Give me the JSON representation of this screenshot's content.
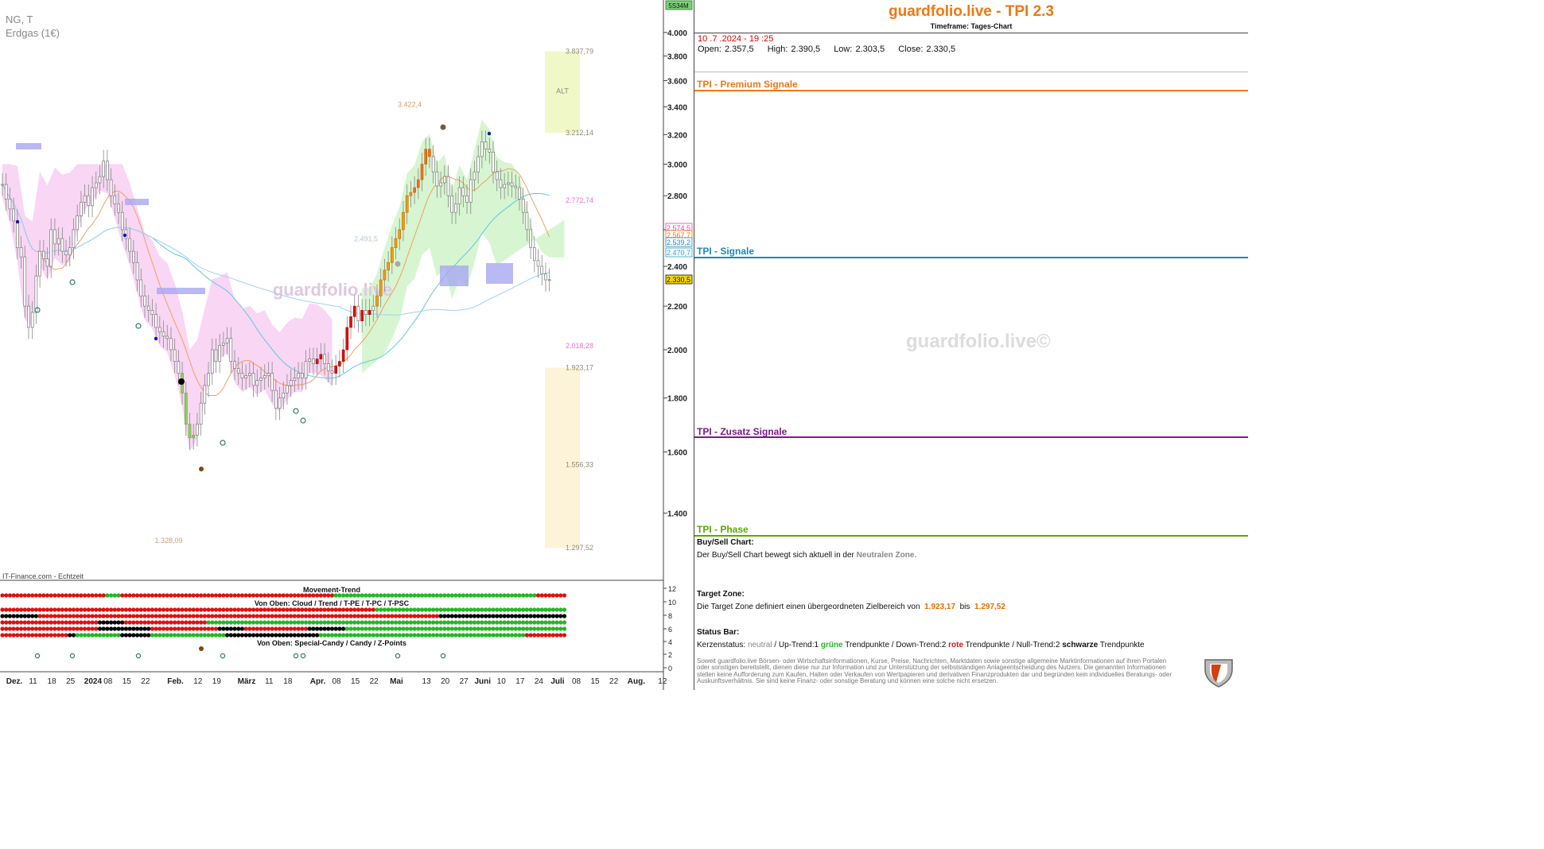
{
  "chart_header": {
    "symbol": "NG, T",
    "name": "Erdgas (1€)"
  },
  "watermark": "guardfolio.live",
  "source_label": "IT-Finance.com - Echtzeit",
  "chart_data": {
    "type": "candlestick",
    "title": "NG, T — Erdgas (1€)",
    "y_range": [
      1250,
      4080
    ],
    "y_ticks": [
      {
        "v": 4000,
        "l": "4.000"
      },
      {
        "v": 3800,
        "l": "3.800"
      },
      {
        "v": 3600,
        "l": "3.600"
      },
      {
        "v": 3400,
        "l": "3.400"
      },
      {
        "v": 3200,
        "l": "3.200"
      },
      {
        "v": 3000,
        "l": "3.000"
      },
      {
        "v": 2800,
        "l": "2.800"
      },
      {
        "v": 2600,
        "l": "2.600"
      },
      {
        "v": 2400,
        "l": "2.400"
      },
      {
        "v": 2200,
        "l": "2.200"
      },
      {
        "v": 2000,
        "l": "2.000"
      },
      {
        "v": 1800,
        "l": "1.800"
      },
      {
        "v": 1600,
        "l": "1.600"
      },
      {
        "v": 1400,
        "l": "1.400"
      }
    ],
    "x_ticks": [
      {
        "i": 0,
        "l": "Dez.",
        "b": true
      },
      {
        "i": 5,
        "l": "11"
      },
      {
        "i": 10,
        "l": "18"
      },
      {
        "i": 15,
        "l": "25"
      },
      {
        "i": 21,
        "l": "2024",
        "b": true
      },
      {
        "i": 25,
        "l": "08"
      },
      {
        "i": 30,
        "l": "15"
      },
      {
        "i": 35,
        "l": "22"
      },
      {
        "i": 43,
        "l": "Feb.",
        "b": true
      },
      {
        "i": 49,
        "l": "12"
      },
      {
        "i": 54,
        "l": "19"
      },
      {
        "i": 62,
        "l": "März",
        "b": true
      },
      {
        "i": 68,
        "l": "11"
      },
      {
        "i": 73,
        "l": "18"
      },
      {
        "i": 81,
        "l": "Apr.",
        "b": true
      },
      {
        "i": 86,
        "l": "08"
      },
      {
        "i": 91,
        "l": "15"
      },
      {
        "i": 96,
        "l": "22"
      },
      {
        "i": 102,
        "l": "Mai",
        "b": true
      },
      {
        "i": 110,
        "l": "13"
      },
      {
        "i": 115,
        "l": "20"
      },
      {
        "i": 120,
        "l": "27"
      },
      {
        "i": 125,
        "l": "Juni",
        "b": true
      },
      {
        "i": 130,
        "l": "10"
      },
      {
        "i": 135,
        "l": "17"
      },
      {
        "i": 140,
        "l": "24"
      },
      {
        "i": 145,
        "l": "Juli",
        "b": true
      },
      {
        "i": 150,
        "l": "08"
      },
      {
        "i": 155,
        "l": "15"
      },
      {
        "i": 160,
        "l": "22"
      },
      {
        "i": 166,
        "l": "Aug.",
        "b": true
      },
      {
        "i": 173,
        "l": "12"
      }
    ],
    "closes": [
      2870,
      2780,
      2720,
      2650,
      2500,
      2450,
      2200,
      2100,
      2170,
      2350,
      2480,
      2440,
      2400,
      2600,
      2520,
      2550,
      2480,
      2460,
      2500,
      2600,
      2680,
      2760,
      2800,
      2740,
      2850,
      2880,
      2920,
      3020,
      2900,
      2800,
      2750,
      2700,
      2600,
      2550,
      2480,
      2420,
      2330,
      2250,
      2200,
      2180,
      2160,
      2100,
      2080,
      2060,
      2050,
      2000,
      1950,
      1900,
      1820,
      1700,
      1650,
      1660,
      1700,
      1780,
      1850,
      1900,
      2000,
      1950,
      2020,
      2030,
      2050,
      1950,
      1920,
      1900,
      1880,
      1890,
      1900,
      1850,
      1870,
      1880,
      1890,
      1900,
      1830,
      1760,
      1800,
      1820,
      1850,
      1870,
      1880,
      1900,
      1880,
      1950,
      1960,
      1940,
      1960,
      1980,
      1940,
      1910,
      1900,
      1930,
      1950,
      2000,
      2100,
      2150,
      2200,
      2130,
      2180,
      2160,
      2180,
      2200,
      2250,
      2330,
      2380,
      2420,
      2500,
      2550,
      2600,
      2700,
      2800,
      2820,
      2850,
      2900,
      3000,
      3100,
      3050,
      2950,
      2860,
      2880,
      2920,
      2800,
      2700,
      2750,
      2850,
      2800,
      2760,
      2900,
      2950,
      3050,
      3150,
      3100,
      3080,
      2950,
      2900,
      2850,
      2870,
      2880,
      2860,
      2850,
      2780,
      2700,
      2600,
      2500,
      2430,
      2400,
      2360,
      2330,
      2331
    ],
    "indicator_labels": [
      {
        "v": 3837.79,
        "l": "3.837,79",
        "c": "#908878"
      },
      {
        "v": 3212.14,
        "l": "3.212,14",
        "c": "#908878"
      },
      {
        "v": 2772.74,
        "l": "2.772,74",
        "c": "#e870c8"
      },
      {
        "v": 2018.28,
        "l": "2.018,28",
        "c": "#e870c8"
      },
      {
        "v": 1923.17,
        "l": "1.923,17",
        "c": "#908878"
      },
      {
        "v": 1556.33,
        "l": "1.556,33",
        "c": "#908878"
      },
      {
        "v": 1297.52,
        "l": "1.297,52",
        "c": "#908878"
      }
    ],
    "peak_label": {
      "v": 3422.4,
      "l": "3.422,4"
    },
    "trough_label": {
      "v": 1328.09,
      "l": "1.328,09"
    },
    "line_label": {
      "v": 2491.5,
      "l": "2.491,5"
    },
    "alt_zone_label": "ALT",
    "axis_badges": [
      {
        "v": 2574.5,
        "l": "2.574,5",
        "c": "#e040c0",
        "bg": "#fff"
      },
      {
        "v": 2567.7,
        "l": "2.567,7",
        "c": "#f07810",
        "bg": "#fff"
      },
      {
        "v": 2539.2,
        "l": "2.539,2",
        "c": "#2a8ab0",
        "bg": "#fff"
      },
      {
        "v": 2470.7,
        "l": "2.470,7",
        "c": "#2aa0c8",
        "bg": "#fff"
      },
      {
        "v": 2330.5,
        "l": "2.330,5",
        "c": "#111",
        "bg": "#f5d800"
      }
    ],
    "top_badge": "5S34M",
    "sub_axis_ticks": [
      "12",
      "10",
      "8",
      "6",
      "4",
      "2",
      "0"
    ],
    "movement_trend_label": "Movement-Trend",
    "cloud_trend_label": "Von Oben: Cloud / Trend / T-PE / T-PC / T-PSC",
    "special_candy_label": "Von Oben: Special-Candy / Candy / Z-Points"
  },
  "tpi": {
    "title": "guardfolio.live - TPI 2.3",
    "subtitle": "Timeframe: Tages-Chart",
    "date": "10 .7 .2024 - 19 :25",
    "open_label": "Open:",
    "open": "2.357,5",
    "high_label": "High:",
    "high": "2.390,5",
    "low_label": "Low:",
    "low": "2.303,5",
    "close_label": "Close:",
    "close": "2.330,5",
    "premium": "TPI - Premium Signale",
    "signale": "TPI - Signale",
    "zusatz": "TPI - Zusatz Signale",
    "phase": "TPI - Phase",
    "buy_sell_head": "Buy/Sell Chart:",
    "buy_sell_text": "Der Buy/Sell Chart bewegt sich aktuell in der",
    "buy_sell_zone": "Neutralen Zone.",
    "target_head": "Target Zone:",
    "target_text": "Die Target Zone definiert einen übergeordneten Zielbereich von",
    "target_from": "1.923,17",
    "target_bis": "bis",
    "target_to": "1.297,52",
    "status_head": "Status Bar:",
    "status_kerzen": "Kerzenstatus:",
    "status_neutral": "neutral",
    "status_up": "/ Up-Trend:1",
    "status_gruene": "grüne",
    "status_tp1": "Trendpunkte",
    "status_down": "/ Down-Trend:2",
    "status_rote": "rote",
    "status_tp2": "Trendpunkte",
    "status_null": "/ Null-Trend:2",
    "status_schwarze": "schwarze",
    "status_tp3": "Trendpunkte",
    "watermark": "guardfolio.live©",
    "disclaimer": "Soweit guardfolio.live Börsen- oder Wirtschaftsinformationen, Kurse, Preise, Nachrichten, Marktdaten sowie sonstige allgemeine Marktinformationen auf ihren Portalen oder sonstigen bereitstellt, dienen diese nur zur Information und zur Unterstützung der selbstständigen Anlageentscheidung des Nutzers. Die genannten Informationen stellen keine Aufforderung zum Kaufen, Halten oder Verkaufen von Wertpapieren und derivativen Finanzprodukten dar und begründen kein individuelles Beratungs- oder Auskunftsverhältnis. Sie sind keine Finanz- oder sonstige Beratung und können eine solche nicht ersetzen."
  },
  "colors": {
    "brand": "#f07810",
    "premium": "#f07810",
    "signale": "#1a8ab8",
    "zusatz": "#7a1a8a",
    "phase": "#5aaa00",
    "neutral_zone": "#888888",
    "target_value": "#e07000",
    "green": "#22b822",
    "red": "#e01010",
    "black": "#000000"
  }
}
